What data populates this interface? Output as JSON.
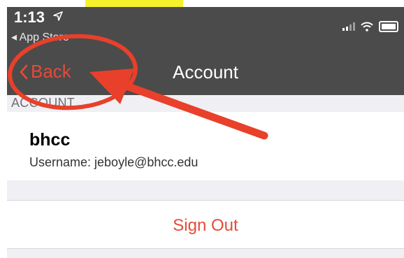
{
  "status_bar": {
    "time": "1:13",
    "location_icon": "location-arrow-icon",
    "back_to_app": "◂ App Store",
    "signal_icon": "cellular-signal-icon",
    "wifi_icon": "wifi-icon",
    "battery_icon": "battery-icon"
  },
  "nav": {
    "back_label": "Back",
    "back_icon": "chevron-left-icon",
    "title": "Account"
  },
  "section": {
    "header": "ACCOUNT"
  },
  "account": {
    "name": "bhcc",
    "username": "Username: jeboyle@bhcc.edu"
  },
  "actions": {
    "sign_out": "Sign Out"
  },
  "colors": {
    "accent": "#e54b38",
    "nav_background": "#4b4b4b",
    "annotation": "#e8402a",
    "highlight": "#f4f22a"
  }
}
